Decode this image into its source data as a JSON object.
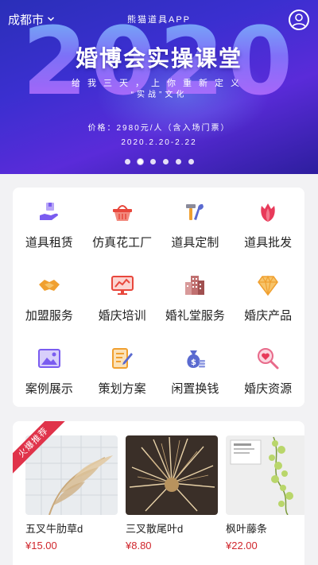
{
  "header": {
    "city": "成都市",
    "brand": "熊猫道具APP",
    "avatar_icon": "user-circle-icon"
  },
  "banner": {
    "year": "2020",
    "headline": "婚博会实操课堂",
    "subline": "给我三天，上你重新定义",
    "subline2": "“实战”文化",
    "price": "价格：2980元/人（含入场门票）",
    "date": "2020.2.20-2.22",
    "slide_count": 6,
    "active_slide": 2
  },
  "categories": [
    {
      "label": "道具租赁",
      "icon": "hand-box-icon",
      "color": "#7a5cf0"
    },
    {
      "label": "仿真花工厂",
      "icon": "basket-icon",
      "color": "#e8473c"
    },
    {
      "label": "道具定制",
      "icon": "tools-icon",
      "color": "#f0a030"
    },
    {
      "label": "道具批发",
      "icon": "tulip-icon",
      "color": "#e83a5a"
    },
    {
      "label": "加盟服务",
      "icon": "handshake-icon",
      "color": "#f0a030"
    },
    {
      "label": "婚庆培训",
      "icon": "monitor-chart-icon",
      "color": "#e8473c"
    },
    {
      "label": "婚礼堂服务",
      "icon": "building-icon",
      "color": "#a05050"
    },
    {
      "label": "婚庆产品",
      "icon": "diamond-icon",
      "color": "#f0a030"
    },
    {
      "label": "案例展示",
      "icon": "picture-icon",
      "color": "#7a5cf0"
    },
    {
      "label": "策划方案",
      "icon": "document-pen-icon",
      "color": "#f0a030"
    },
    {
      "label": "闲置换钱",
      "icon": "money-bag-icon",
      "color": "#5a6ad0"
    },
    {
      "label": "婚庆资源",
      "icon": "heart-search-icon",
      "color": "#e86a8a"
    }
  ],
  "products_section": {
    "ribbon": "火爆推荐",
    "items": [
      {
        "name": "五叉牛肋草d",
        "price": "¥15.00",
        "tag": "五叉牛肋草"
      },
      {
        "name": "三叉散尾叶d",
        "price": "¥8.80"
      },
      {
        "name": "枫叶藤条",
        "price": "¥22.00",
        "tag": "枫叶藤条"
      }
    ]
  },
  "colors": {
    "price": "#d0262c",
    "ribbon": "#e0334a",
    "banner_start": "#2a2fb8",
    "banner_end": "#5a2bd9"
  }
}
